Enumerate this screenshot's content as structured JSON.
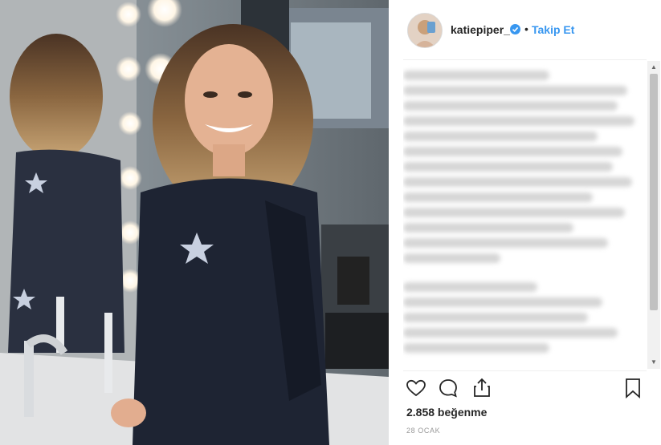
{
  "post": {
    "username": "katiepiper_",
    "separator": "•",
    "follow_label": "Takip Et",
    "likes_text": "2.858 beğenme",
    "date_text": "28 OCAK"
  },
  "colors": {
    "link": "#3897f0",
    "text": "#262626",
    "muted": "#999999"
  },
  "icons": [
    "heart-icon",
    "comment-icon",
    "share-icon",
    "bookmark-icon",
    "verified-icon"
  ]
}
